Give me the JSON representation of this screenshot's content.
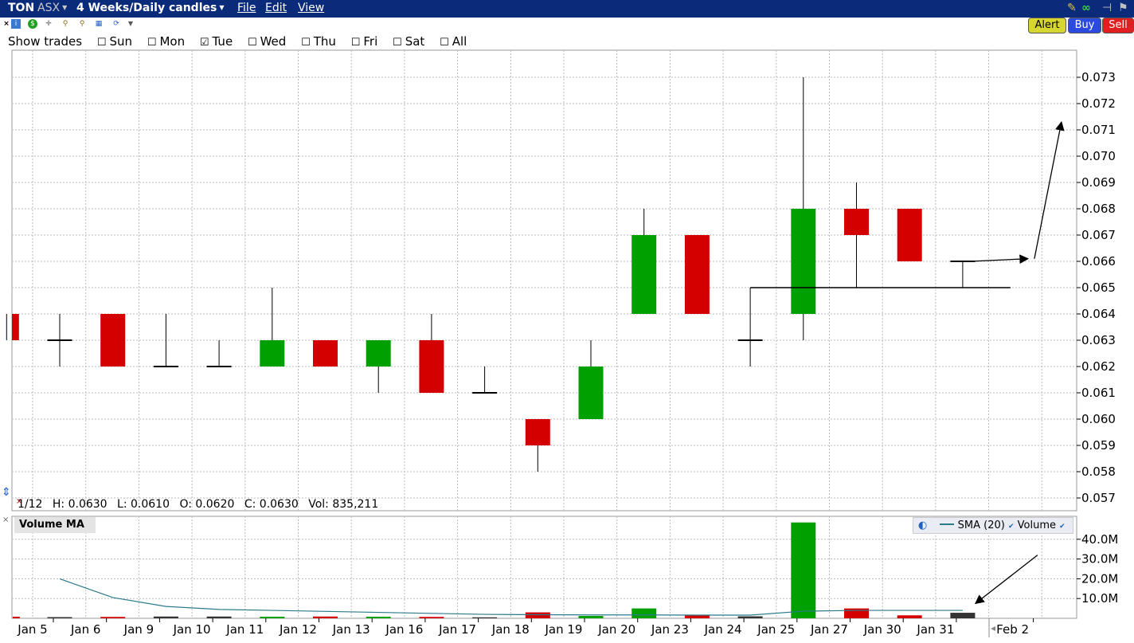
{
  "window": {
    "symbol": "TON",
    "exchange": "ASX",
    "timeframe": "4 Weeks/Daily candles",
    "menus": [
      "File",
      "Edit",
      "View"
    ]
  },
  "order_buttons": {
    "alert": "Alert",
    "buy": "Buy",
    "sell": "Sell"
  },
  "show_trades": {
    "label": "Show trades",
    "days": [
      {
        "label": "Sun",
        "checked": false
      },
      {
        "label": "Mon",
        "checked": false
      },
      {
        "label": "Tue",
        "checked": true
      },
      {
        "label": "Wed",
        "checked": false
      },
      {
        "label": "Thu",
        "checked": false
      },
      {
        "label": "Fri",
        "checked": false
      },
      {
        "label": "Sat",
        "checked": false
      },
      {
        "label": "All",
        "checked": false
      }
    ]
  },
  "info_bar": {
    "date": "1/12",
    "high": "H: 0.0630",
    "low": "L: 0.0610",
    "open": "O: 0.0620",
    "close": "C: 0.0630",
    "volume": "Vol: 835,211"
  },
  "volume_panel": {
    "title": "Volume MA",
    "legend_sma": "SMA (20)",
    "legend_volume": "Volume"
  },
  "colors": {
    "up": "#00a000",
    "down": "#d40000",
    "neutral": "#000000",
    "sma": "#2b7a8a",
    "titlebar": "#0a2a7a"
  },
  "chart_data": {
    "type": "candlestick",
    "x_tick_labels": [
      "Jan 5",
      "Jan 6",
      "Jan 9",
      "Jan 10",
      "Jan 11",
      "Jan 12",
      "Jan 13",
      "Jan 16",
      "Jan 17",
      "Jan 18",
      "Jan 19",
      "Jan 20",
      "Jan 23",
      "Jan 24",
      "Jan 25",
      "Jan 27",
      "Jan 30",
      "Jan 31",
      "Feb 2"
    ],
    "price_axis": {
      "ylim": [
        0.0565,
        0.0735
      ],
      "ticks": [
        "0.057",
        "0.058",
        "0.059",
        "0.060",
        "0.061",
        "0.062",
        "0.063",
        "0.064",
        "0.065",
        "0.066",
        "0.067",
        "0.068",
        "0.069",
        "0.070",
        "0.071",
        "0.072",
        "0.073"
      ]
    },
    "candles": [
      {
        "o": 0.064,
        "h": 0.064,
        "l": 0.063,
        "c": 0.063
      },
      {
        "o": 0.063,
        "h": 0.064,
        "l": 0.062,
        "c": 0.063
      },
      {
        "o": 0.064,
        "h": 0.064,
        "l": 0.062,
        "c": 0.062
      },
      {
        "o": 0.062,
        "h": 0.064,
        "l": 0.062,
        "c": 0.062
      },
      {
        "o": 0.062,
        "h": 0.063,
        "l": 0.062,
        "c": 0.062
      },
      {
        "o": 0.062,
        "h": 0.065,
        "l": 0.062,
        "c": 0.063
      },
      {
        "o": 0.063,
        "h": 0.063,
        "l": 0.062,
        "c": 0.062
      },
      {
        "o": 0.062,
        "h": 0.063,
        "l": 0.061,
        "c": 0.063
      },
      {
        "o": 0.063,
        "h": 0.064,
        "l": 0.061,
        "c": 0.061
      },
      {
        "o": 0.061,
        "h": 0.062,
        "l": 0.061,
        "c": 0.061
      },
      {
        "o": 0.06,
        "h": 0.06,
        "l": 0.058,
        "c": 0.059
      },
      {
        "o": 0.06,
        "h": 0.063,
        "l": 0.06,
        "c": 0.062
      },
      {
        "o": 0.064,
        "h": 0.068,
        "l": 0.064,
        "c": 0.067
      },
      {
        "o": 0.067,
        "h": 0.067,
        "l": 0.064,
        "c": 0.064
      },
      {
        "o": 0.063,
        "h": 0.065,
        "l": 0.062,
        "c": 0.063
      },
      {
        "o": 0.064,
        "h": 0.073,
        "l": 0.063,
        "c": 0.068
      },
      {
        "o": 0.068,
        "h": 0.069,
        "l": 0.065,
        "c": 0.067
      },
      {
        "o": 0.068,
        "h": 0.068,
        "l": 0.066,
        "c": 0.066
      },
      {
        "o": 0.066,
        "h": 0.066,
        "l": 0.065,
        "c": 0.066
      }
    ],
    "volume_axis": {
      "ylim": [
        0,
        50
      ],
      "unit": "M",
      "ticks": [
        "10.0M",
        "20.0M",
        "30.0M",
        "40.0M"
      ]
    },
    "volumes_m": [
      0.8,
      0.6,
      0.7,
      0.9,
      0.9,
      0.8,
      0.9,
      0.8,
      0.7,
      0.5,
      3.0,
      1.2,
      5.0,
      1.8,
      1.0,
      48.5,
      5.0,
      1.5,
      2.8
    ],
    "sma20_m": [
      null,
      20.0,
      10.5,
      6.0,
      4.5,
      4.0,
      3.5,
      3.0,
      2.5,
      2.0,
      1.8,
      1.7,
      1.7,
      1.6,
      1.6,
      3.6,
      4.0,
      4.0,
      4.0
    ],
    "annotations": [
      {
        "type": "support-line",
        "price": 0.065
      },
      {
        "type": "arrow",
        "from_price": 0.066,
        "to_price": 0.0661
      },
      {
        "type": "arrow",
        "from_price": 0.0661,
        "to_price": 0.0713
      },
      {
        "type": "arrow",
        "panel": "volume"
      }
    ]
  }
}
